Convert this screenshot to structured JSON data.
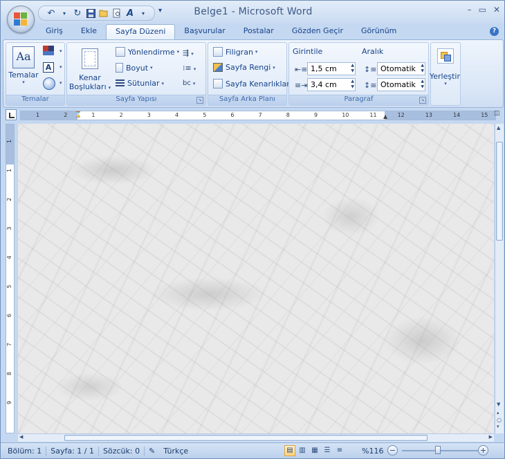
{
  "app": {
    "title": "Belge1 - Microsoft Word"
  },
  "quick_access": {
    "undo_icon": "undo-icon",
    "redo_icon": "redo-icon",
    "save_icon": "save-icon"
  },
  "tabs": [
    {
      "label": "Giriş"
    },
    {
      "label": "Ekle"
    },
    {
      "label": "Sayfa Düzeni",
      "active": true
    },
    {
      "label": "Başvurular"
    },
    {
      "label": "Postalar"
    },
    {
      "label": "Gözden Geçir"
    },
    {
      "label": "Görünüm"
    }
  ],
  "ribbon": {
    "temalar": {
      "button_label": "Temalar",
      "group_label": "Temalar"
    },
    "sayfa_yapisi": {
      "margins_line1": "Kenar",
      "margins_line2": "Boşlukları",
      "orientation": "Yönlendirme",
      "size": "Boyut",
      "columns": "Sütunlar",
      "group_label": "Sayfa Yapısı"
    },
    "sayfa_arka_plani": {
      "watermark": "Filigran",
      "page_color": "Sayfa Rengi",
      "page_borders": "Sayfa Kenarlıkları",
      "group_label": "Sayfa Arka Planı"
    },
    "paragraf": {
      "indent_label": "Girintile",
      "spacing_label": "Aralık",
      "indent_left": "1,5 cm",
      "indent_right": "3,4 cm",
      "spacing_before": "Otomatik",
      "spacing_after": "Otomatik",
      "group_label": "Paragraf"
    },
    "arrange": {
      "button_label": "Yerleştir"
    }
  },
  "ruler": {
    "h_ticks": [
      "1",
      "2",
      "1",
      "2",
      "3",
      "4",
      "5",
      "6",
      "7",
      "8",
      "9",
      "10",
      "11",
      "12",
      "13",
      "14",
      "15"
    ],
    "v_ticks": [
      "1",
      "1",
      "2",
      "3",
      "4",
      "5",
      "6",
      "7",
      "8",
      "9"
    ]
  },
  "status": {
    "section": "Bölüm: 1",
    "page": "Sayfa: 1 / 1",
    "words": "Sözcük: 0",
    "language": "Türkçe",
    "zoom": "%116"
  }
}
